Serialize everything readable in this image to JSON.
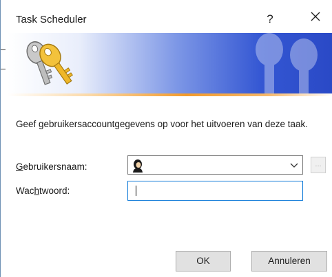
{
  "window": {
    "title": "Task Scheduler",
    "help_label": "?",
    "close_label": "close",
    "accent_color": "#0b78d7"
  },
  "banner": {
    "icon": "keys-icon",
    "gradient_colors": [
      "#ffffff",
      "#3457d3"
    ],
    "underline_color": "#f39a2a"
  },
  "form": {
    "description": "Geef gebruikersaccountgegevens op voor het uitvoeren van deze taak.",
    "username": {
      "label_pre": "",
      "label_access": "G",
      "label_post": "ebruikersnaam:",
      "value": "",
      "icon": "user-icon",
      "dropdown_icon": "chevron-down-icon"
    },
    "browse_label": "...",
    "password": {
      "label_pre": "Wac",
      "label_access": "h",
      "label_post": "twoord:",
      "value": ""
    }
  },
  "buttons": {
    "ok": "OK",
    "cancel": "Annuleren"
  }
}
